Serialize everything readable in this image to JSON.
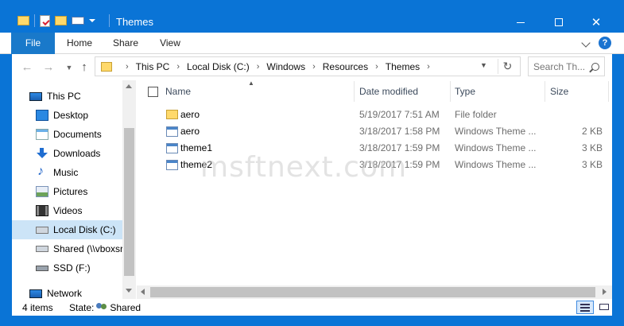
{
  "window": {
    "title": "Themes",
    "accent": "#0a74d6",
    "minimize": "—",
    "maximize": "□",
    "close": "✕"
  },
  "ribbon": {
    "tabs": [
      {
        "label": "File"
      },
      {
        "label": "Home"
      },
      {
        "label": "Share"
      },
      {
        "label": "View"
      }
    ],
    "help": "?"
  },
  "address": {
    "crumbs": [
      "This PC",
      "Local Disk (C:)",
      "Windows",
      "Resources",
      "Themes"
    ],
    "search_placeholder": "Search Th..."
  },
  "nav": {
    "items": [
      {
        "label": "This PC",
        "icon": "pc-icon"
      },
      {
        "label": "Desktop",
        "icon": "desktop-icon"
      },
      {
        "label": "Documents",
        "icon": "documents-icon"
      },
      {
        "label": "Downloads",
        "icon": "downloads-icon"
      },
      {
        "label": "Music",
        "icon": "music-icon"
      },
      {
        "label": "Pictures",
        "icon": "pictures-icon"
      },
      {
        "label": "Videos",
        "icon": "videos-icon"
      },
      {
        "label": "Local Disk (C:)",
        "icon": "local-disk-icon",
        "selected": true
      },
      {
        "label": "Shared (\\\\vboxsr",
        "icon": "network-drive-icon"
      },
      {
        "label": "SSD (F:)",
        "icon": "ssd-icon"
      },
      {
        "label": "Network",
        "icon": "network-icon"
      }
    ]
  },
  "columns": {
    "name": "Name",
    "date": "Date modified",
    "type": "Type",
    "size": "Size"
  },
  "files": [
    {
      "name": "aero",
      "date": "5/19/2017 7:51 AM",
      "type": "File folder",
      "size": "",
      "icon": "folder-icon"
    },
    {
      "name": "aero",
      "date": "3/18/2017 1:58 PM",
      "type": "Windows Theme ...",
      "size": "2 KB",
      "icon": "theme-file-icon"
    },
    {
      "name": "theme1",
      "date": "3/18/2017 1:59 PM",
      "type": "Windows Theme ...",
      "size": "3 KB",
      "icon": "theme-file-icon"
    },
    {
      "name": "theme2",
      "date": "3/18/2017 1:59 PM",
      "type": "Windows Theme ...",
      "size": "3 KB",
      "icon": "theme-file-icon"
    }
  ],
  "watermark": "msftnext.com",
  "status": {
    "items": "4 items",
    "state_label": "State:",
    "state_value": "Shared"
  }
}
